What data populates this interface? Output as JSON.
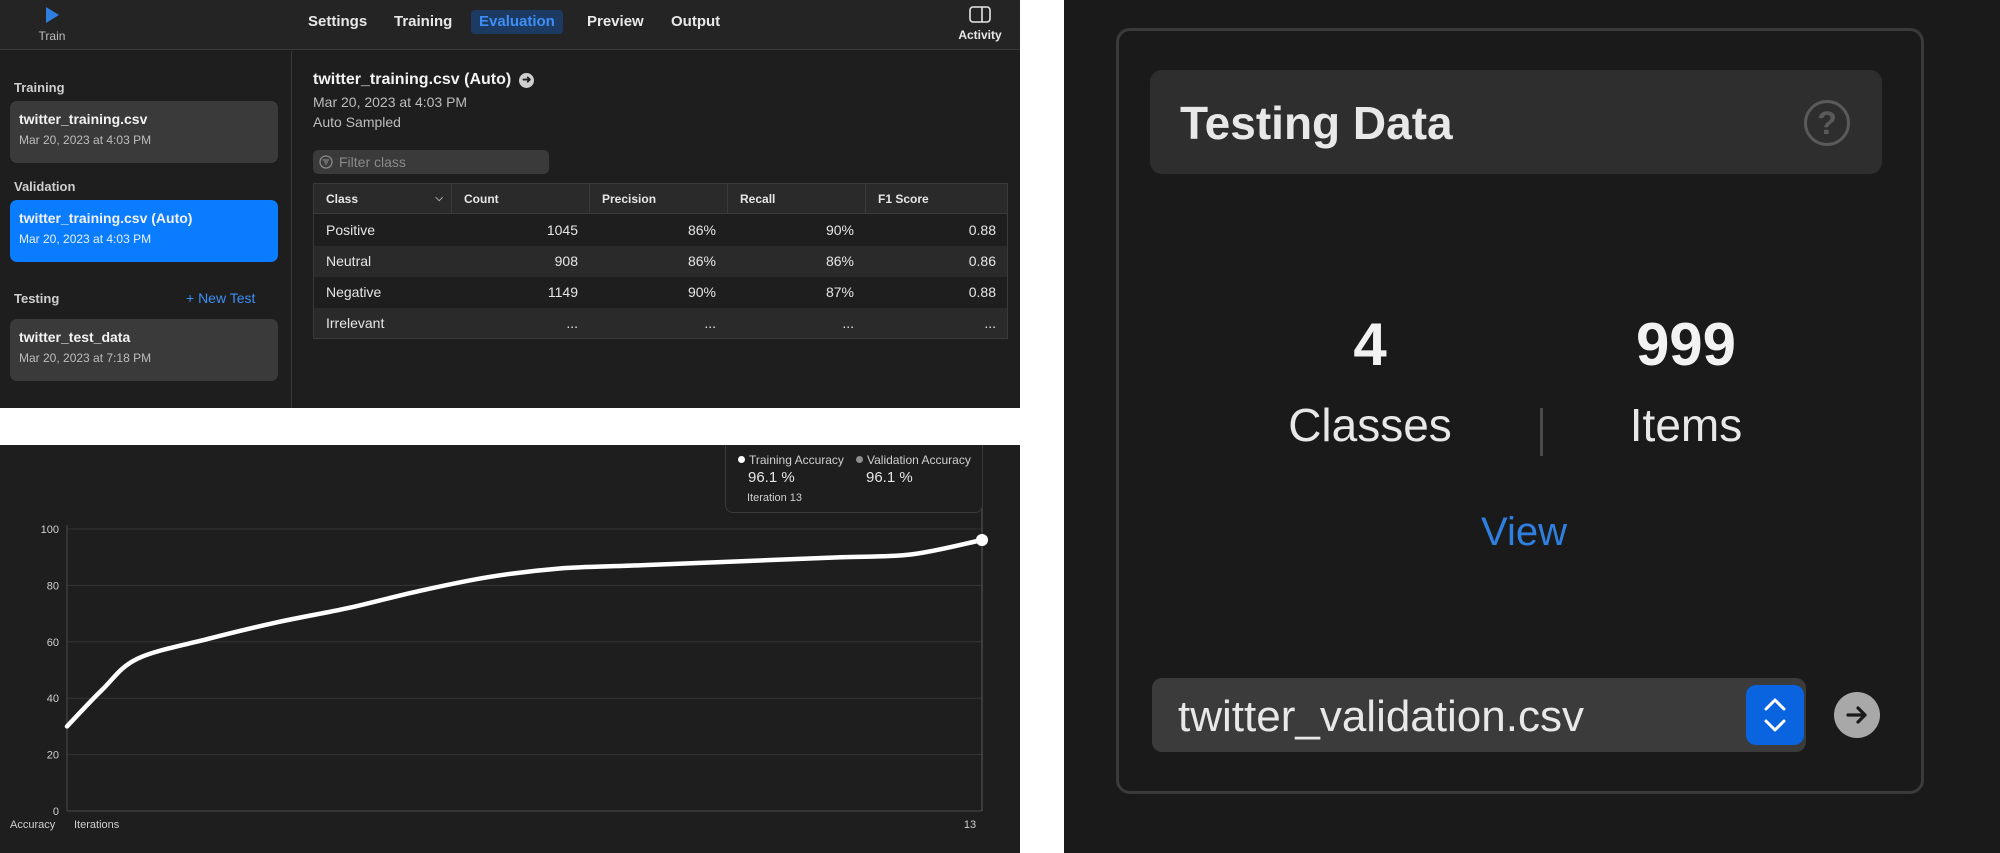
{
  "toolbar": {
    "train_label": "Train",
    "activity_label": "Activity",
    "tabs": [
      {
        "label": "Settings"
      },
      {
        "label": "Training"
      },
      {
        "label": "Evaluation",
        "active": true
      },
      {
        "label": "Preview"
      },
      {
        "label": "Output"
      }
    ]
  },
  "sidebar": {
    "training_title": "Training",
    "validation_title": "Validation",
    "testing_title": "Testing",
    "new_test_label": "+ New Test",
    "training": {
      "name": "twitter_training.csv",
      "date": "Mar 20, 2023 at 4:03 PM"
    },
    "validation": {
      "name": "twitter_training.csv (Auto)",
      "date": "Mar 20, 2023 at 4:03 PM"
    },
    "testing": {
      "name": "twitter_test_data",
      "date": "Mar 20, 2023 at 7:18 PM"
    }
  },
  "evaluation": {
    "title": "twitter_training.csv (Auto)",
    "date": "Mar 20, 2023 at 4:03 PM",
    "sampling": "Auto Sampled",
    "filter_placeholder": "Filter class",
    "columns": [
      "Class",
      "Count",
      "Precision",
      "Recall",
      "F1 Score"
    ],
    "rows": [
      [
        "Positive",
        "1045",
        "86%",
        "90%",
        "0.88"
      ],
      [
        "Neutral",
        "908",
        "86%",
        "86%",
        "0.86"
      ],
      [
        "Negative",
        "1149",
        "90%",
        "87%",
        "0.88"
      ],
      [
        "Irrelevant",
        "...",
        "...",
        "...",
        "..."
      ]
    ]
  },
  "chart_data": {
    "type": "line",
    "xlabel": "Iterations",
    "ylabel": "Accuracy",
    "ylim": [
      0,
      100
    ],
    "yticks": [
      0,
      20,
      40,
      60,
      80,
      100
    ],
    "xticks": [
      13
    ],
    "xlim": [
      0,
      13
    ],
    "grid": true,
    "legend_position": "top-right",
    "series": [
      {
        "name": "Training Accuracy",
        "color": "#ffffff",
        "x": [
          0,
          0.5,
          1,
          2,
          3,
          4,
          5,
          6,
          7,
          8,
          9,
          10,
          11,
          12,
          13
        ],
        "values": [
          30,
          43,
          54,
          61,
          67,
          72,
          78,
          83,
          86,
          87,
          88,
          89,
          90,
          91,
          96.1
        ]
      },
      {
        "name": "Validation Accuracy",
        "color": "#8e8e8e",
        "x": [
          13
        ],
        "values": [
          96.1
        ]
      }
    ],
    "readout": {
      "training_value": "96.1 %",
      "validation_value": "96.1 %",
      "iteration": "Iteration 13"
    }
  },
  "testing_data": {
    "title": "Testing Data",
    "help_icon": "?",
    "classes_count": "4",
    "classes_label": "Classes",
    "items_count": "999",
    "items_label": "Items",
    "view_label": "View",
    "selected_file": "twitter_validation.csv"
  },
  "colors": {
    "accent": "#0a7cff",
    "link": "#3d8ff5",
    "background": "#1e1e1e"
  }
}
